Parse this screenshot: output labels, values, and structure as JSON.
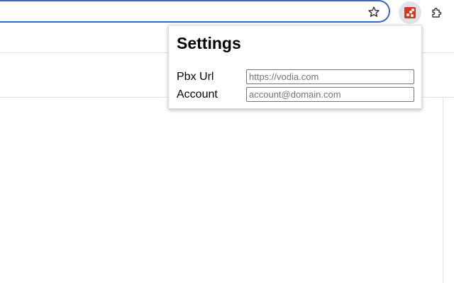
{
  "toolbar": {
    "icons": [
      "star-icon",
      "extension-vodia-icon",
      "puzzle-icon"
    ]
  },
  "popup": {
    "title": "Settings",
    "fields": [
      {
        "label": "Pbx Url",
        "placeholder": "https://vodia.com",
        "value": ""
      },
      {
        "label": "Account",
        "placeholder": "account@domain.com",
        "value": ""
      }
    ]
  },
  "colors": {
    "omnibox_border": "#3569c7",
    "extension_logo": "#d7361f",
    "extension_button_bg": "#dfe3e8"
  }
}
